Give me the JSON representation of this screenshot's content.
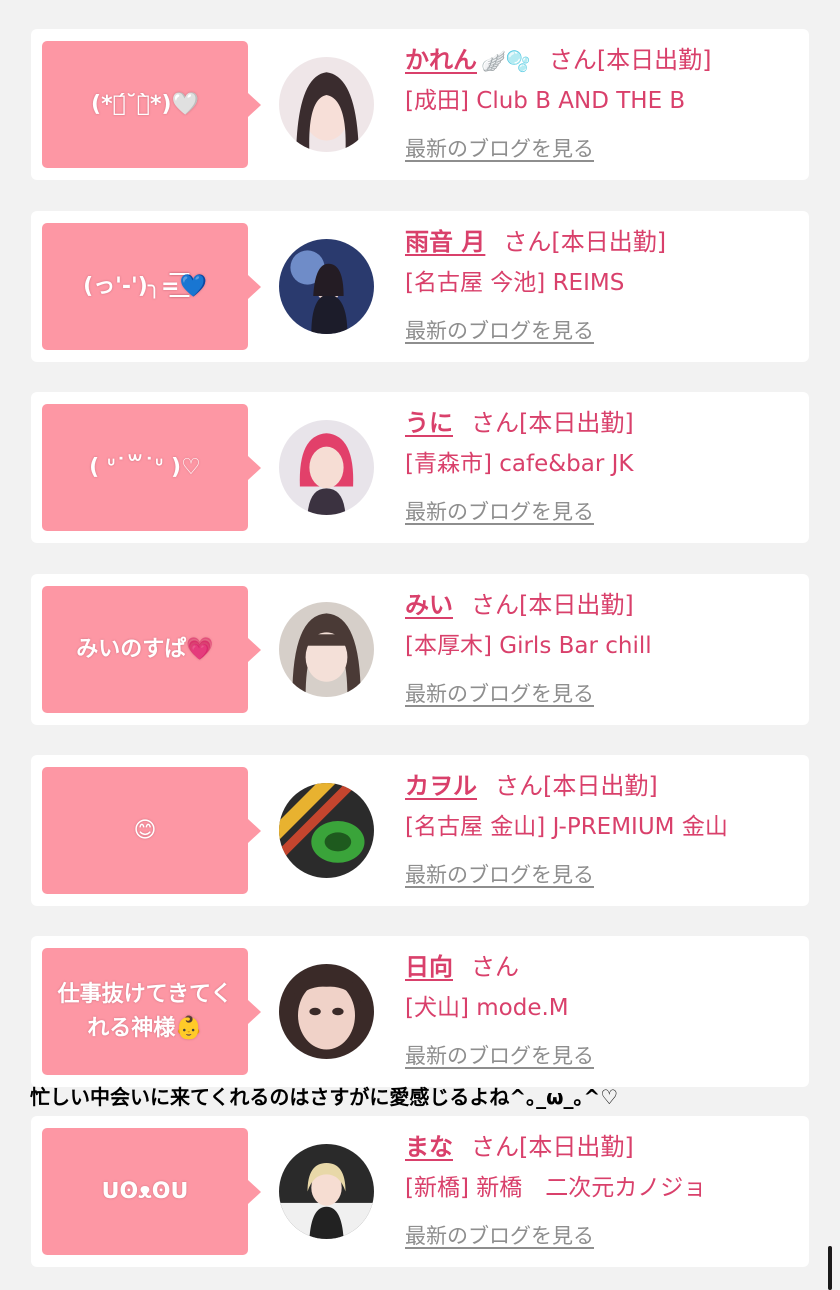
{
  "cards": [
    {
      "emote": "(*ฅ́˘ฅ̀*)🤍",
      "name": "かれん",
      "name_deco": "🪽🫧",
      "san": "さん",
      "status": "[本日出勤]",
      "shop": "[成田] Club B AND THE B",
      "blog": "最新のブログを見る"
    },
    {
      "emote": "(っ'-')╮=͟͟͞͞💙",
      "name": "雨音 月",
      "name_deco": "",
      "san": "さん",
      "status": "[本日出勤]",
      "shop": "[名古屋 今池] REIMS",
      "blog": "最新のブログを見る"
    },
    {
      "emote": "( ᐡ˙꒳˙ᐡ )♡",
      "name": "うに",
      "name_deco": "",
      "san": "さん",
      "status": "[本日出勤]",
      "shop": "[青森市] cafe&bar JK",
      "blog": "最新のブログを見る"
    },
    {
      "emote": "みいのすぱ💗",
      "name": "みい",
      "name_deco": "",
      "san": "さん",
      "status": "[本日出勤]",
      "shop": "[本厚木] Girls Bar chill",
      "blog": "最新のブログを見る"
    },
    {
      "emote": "😊",
      "name": "カヲル",
      "name_deco": "",
      "san": "さん",
      "status": "[本日出勤]",
      "shop": "[名古屋 金山] J-PREMIUM 金山",
      "blog": "最新のブログを見る"
    },
    {
      "emote": "仕事抜けてきてくれる神様👶",
      "name": "日向",
      "name_deco": "",
      "san": "さん",
      "status": "",
      "shop": "[犬山] mode.M",
      "blog": "最新のブログを見る"
    },
    {
      "emote": "ᑌʘᴥʘᑌ",
      "name": "まな",
      "name_deco": "",
      "san": "さん",
      "status": "[本日出勤]",
      "shop": "[新橋] 新橋　二次元カノジョ",
      "blog": "最新のブログを見る"
    }
  ],
  "overlay_comment": "忙しい中会いに来てくれるのはさすがに愛感じるよね^｡_ω_｡^♡",
  "colors": {
    "accent": "#d9406b",
    "bubble": "#fd97a4",
    "link": "#8e8e8e",
    "background": "#f2f2f2"
  }
}
